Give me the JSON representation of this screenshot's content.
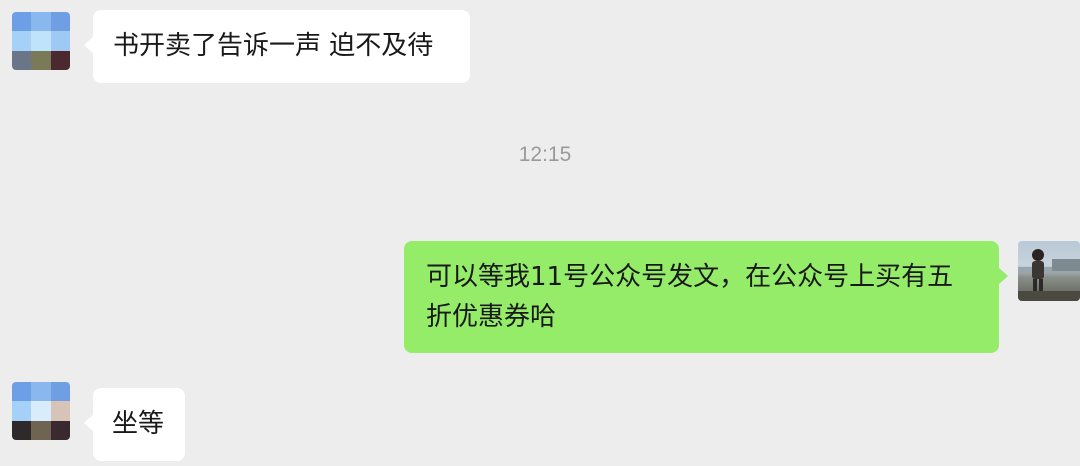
{
  "chat": {
    "timestamp": "12:15",
    "messages": [
      {
        "sender": "contact",
        "text": "书开卖了告诉一声 迫不及待"
      },
      {
        "sender": "me",
        "text": "可以等我11号公众号发文，在公众号上买有五折优惠券哈"
      },
      {
        "sender": "contact",
        "text": "坐等"
      }
    ]
  },
  "colors": {
    "background": "#ededed",
    "incoming_bubble": "#ffffff",
    "outgoing_bubble": "#95ec69",
    "timestamp_text": "#9a9a9a"
  }
}
